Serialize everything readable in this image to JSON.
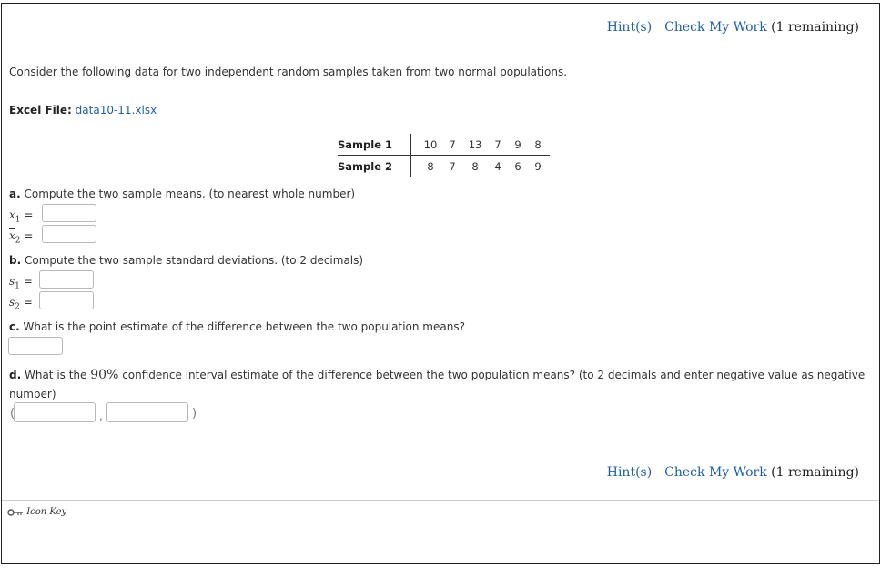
{
  "hints": {
    "hint_label": "Hint(s)",
    "check_label": "Check My Work",
    "remaining": "(1 remaining)"
  },
  "question": {
    "intro": "Consider the following data for two independent random samples taken from two normal populations.",
    "excel_label": "Excel File:",
    "excel_file": "data10-11.xlsx"
  },
  "table": {
    "sample1_label": "Sample 1",
    "sample2_label": "Sample 2",
    "sample1": [
      "10",
      "7",
      "13",
      "7",
      "9",
      "8"
    ],
    "sample2": [
      "8",
      "7",
      "8",
      "4",
      "6",
      "9"
    ]
  },
  "part_a": {
    "letter": "a.",
    "text": "Compute the two sample means. (to nearest whole number)",
    "x1": "x",
    "x1_sub": "1",
    "x2": "x",
    "x2_sub": "2",
    "eq": "="
  },
  "part_b": {
    "letter": "b.",
    "text": "Compute the two sample standard deviations. (to 2 decimals)",
    "s1": "s",
    "s1_sub": "1",
    "s2": "s",
    "s2_sub": "2",
    "eq": "="
  },
  "part_c": {
    "letter": "c.",
    "text": "What is the point estimate of the difference between the two population means?"
  },
  "part_d": {
    "letter": "d.",
    "text_before": "What is the ",
    "percent": "90%",
    "text_after": " confidence interval estimate of the difference between the two population means? (to 2 decimals and enter negative value as negative number)",
    "open_paren": "(",
    "comma": ",",
    "close_paren": ")"
  },
  "footer": {
    "icon_key": "Icon Key"
  }
}
